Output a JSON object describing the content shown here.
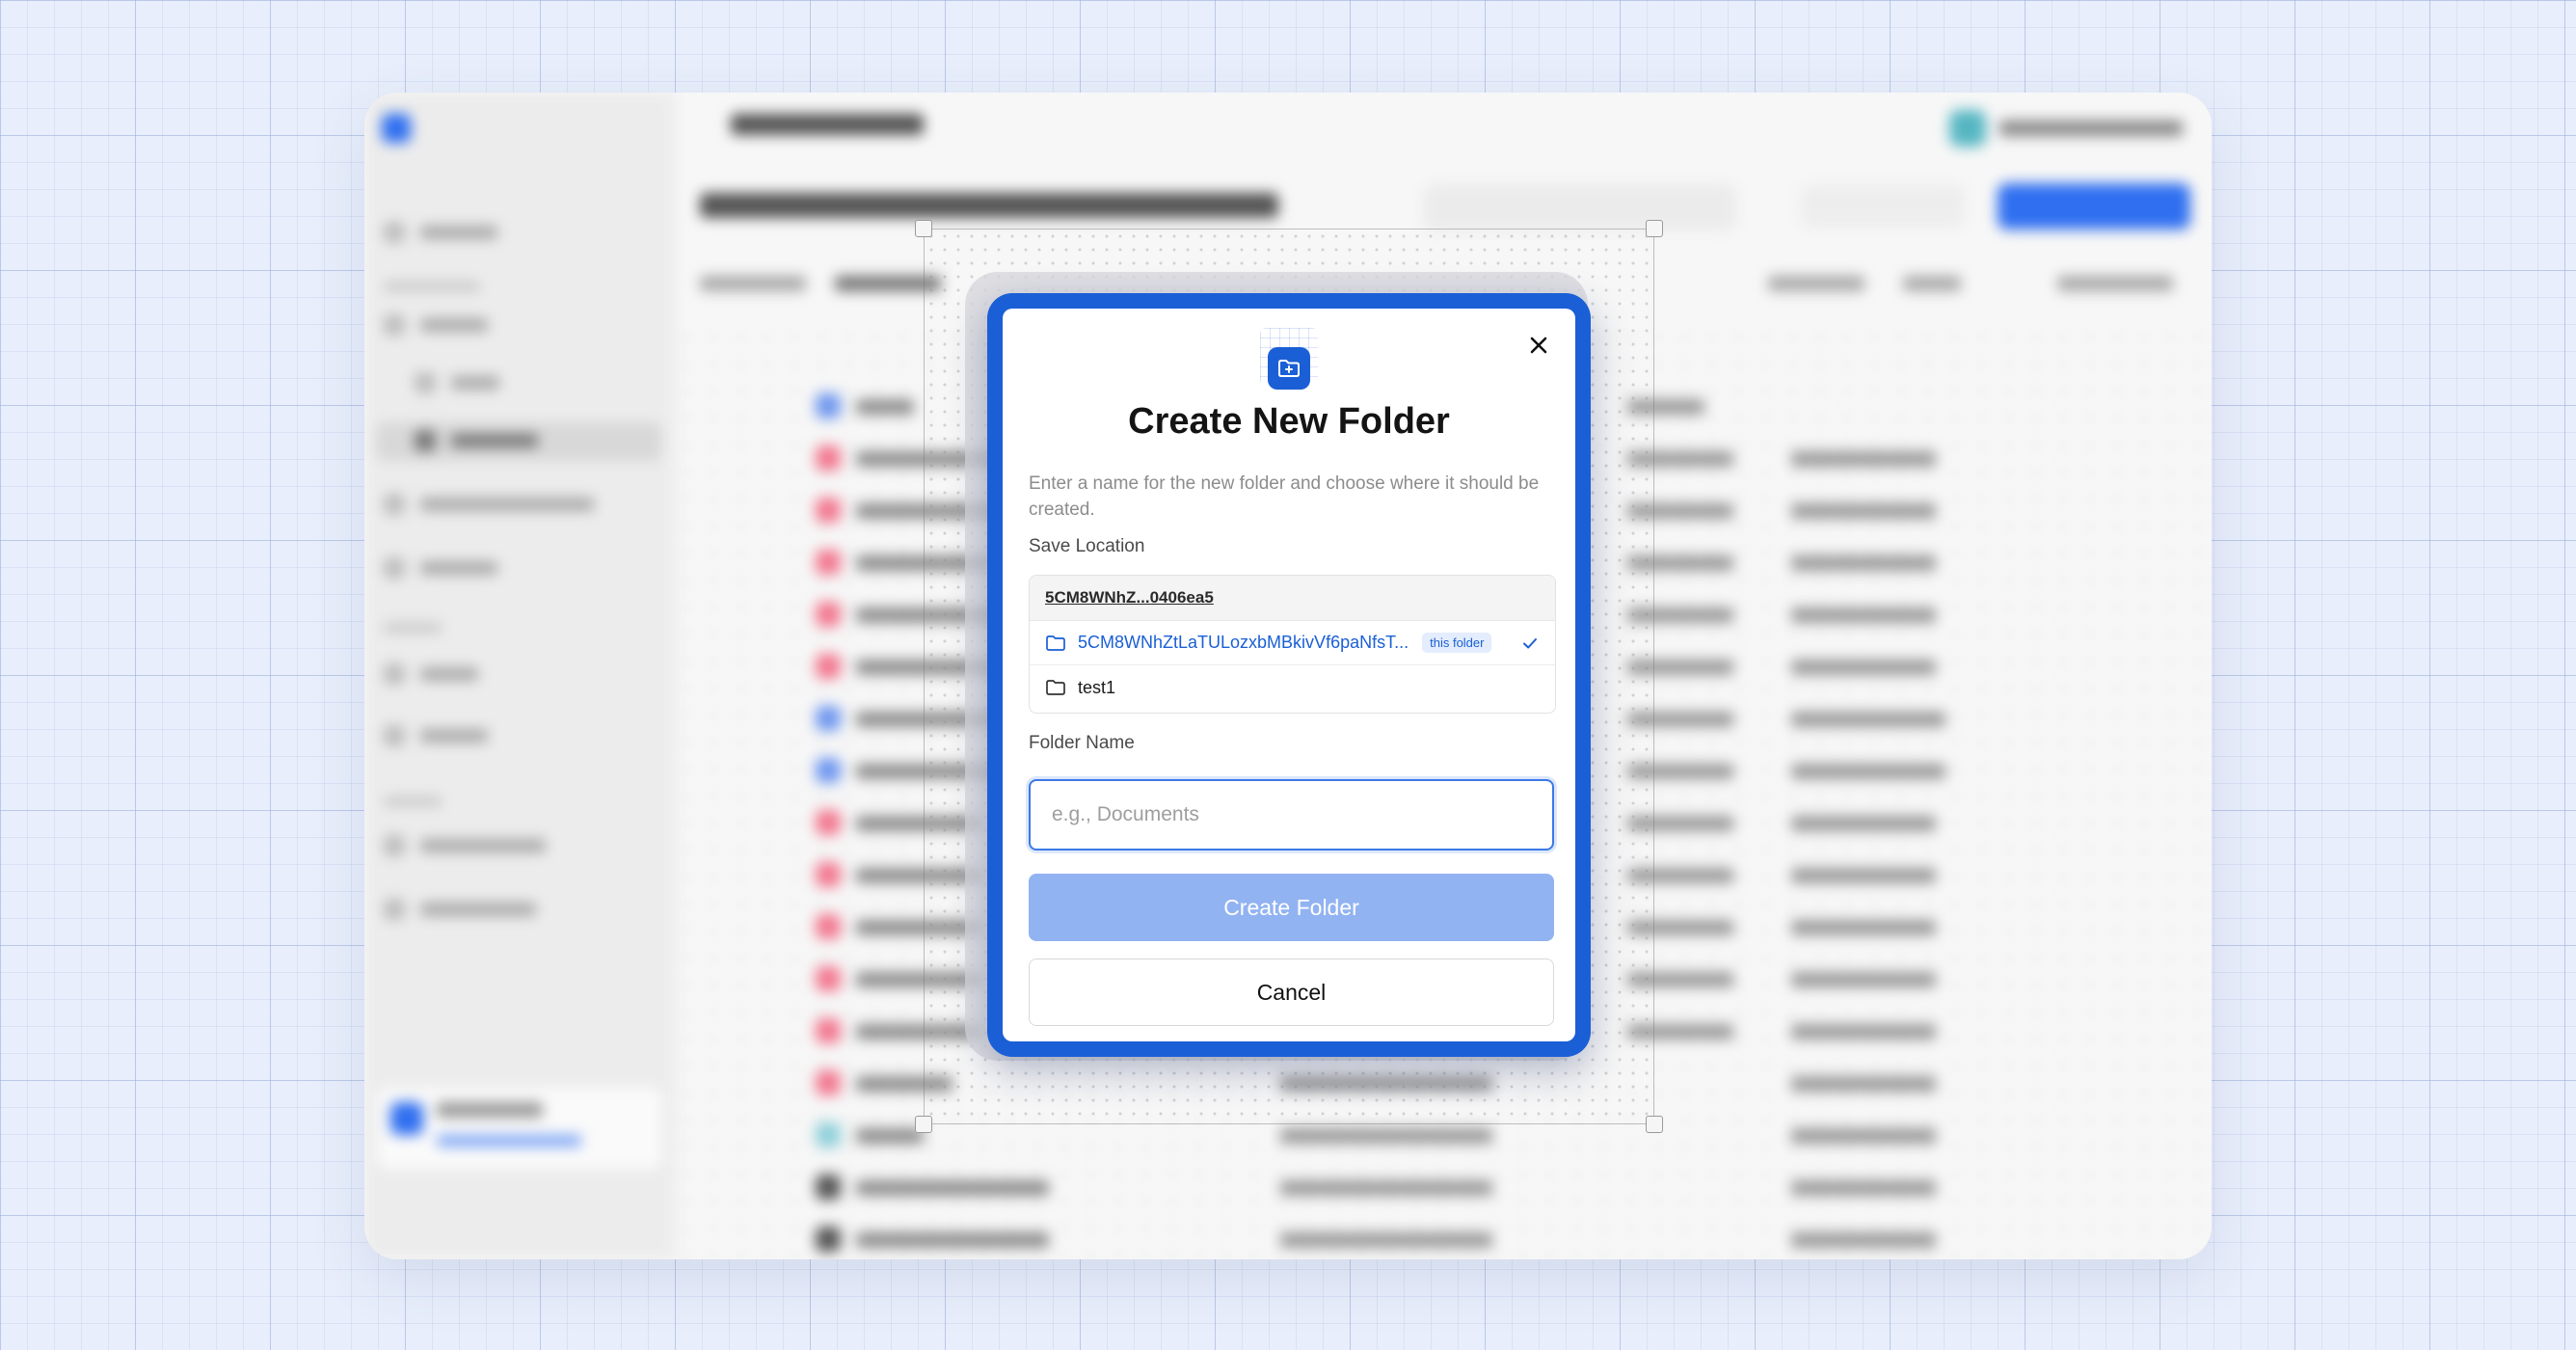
{
  "dialog": {
    "title": "Create New Folder",
    "description": "Enter a name for the new folder and choose where it should be created.",
    "save_location_label": "Save Location",
    "breadcrumb": "5CM8WNhZ...0406ea5",
    "folders": [
      {
        "name": "5CM8WNhZtLaTULozxbMBkivVf6paNfsT...",
        "badge": "this folder",
        "selected": true
      },
      {
        "name": "test1",
        "badge": "",
        "selected": false
      }
    ],
    "folder_name_label": "Folder Name",
    "folder_name_placeholder": "e.g., Documents",
    "folder_name_value": "",
    "create_button": "Create Folder",
    "cancel_button": "Cancel"
  },
  "colors": {
    "accent": "#1a5fd6",
    "button_disabled": "#92b3f2",
    "input_focus": "#3b78e6",
    "page_background": "#e8eefb"
  },
  "icons": {
    "header": "folder-plus-icon",
    "close": "close-icon",
    "folder": "folder-icon",
    "selected": "check-icon"
  }
}
